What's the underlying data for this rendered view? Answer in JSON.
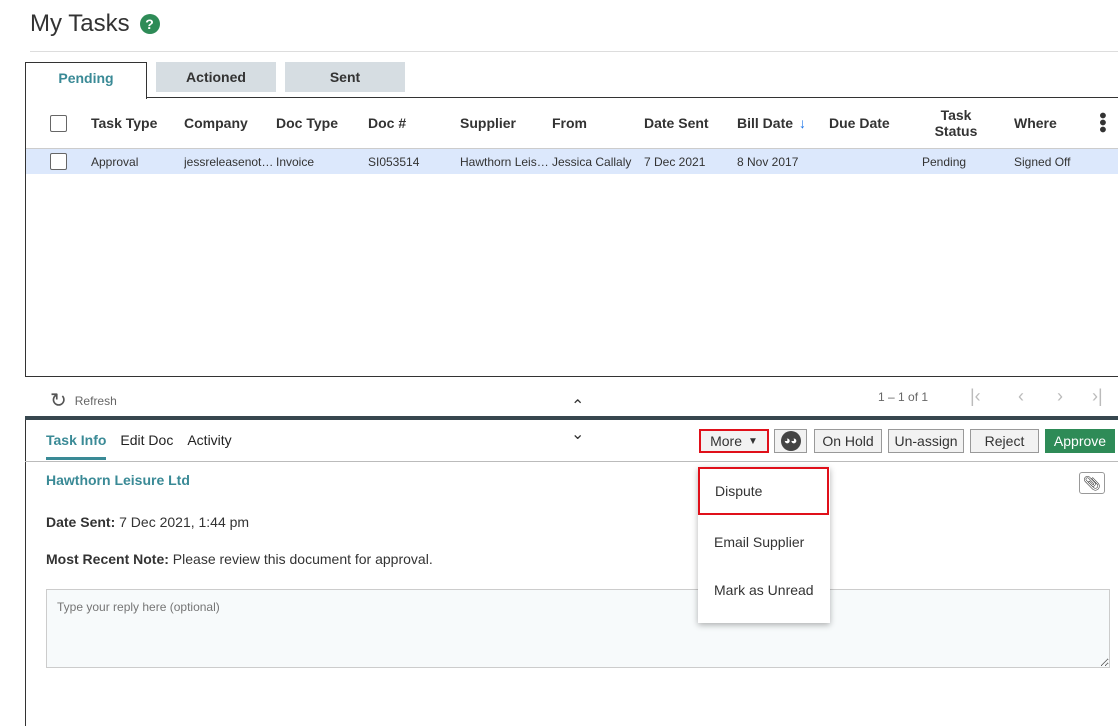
{
  "page": {
    "title": "My Tasks",
    "help_icon": "?"
  },
  "tabs": [
    {
      "label": "Pending",
      "active": true
    },
    {
      "label": "Actioned",
      "active": false
    },
    {
      "label": "Sent",
      "active": false
    }
  ],
  "grid": {
    "columns": [
      "Task Type",
      "Company",
      "Doc Type",
      "Doc #",
      "Supplier",
      "From",
      "Date Sent",
      "Bill Date",
      "Due Date",
      "Task Status",
      "Where"
    ],
    "sort_indicator": "↓",
    "rows": [
      {
        "task_type": "Approval",
        "company": "jessreleasenot…",
        "doc_type": "Invoice",
        "doc_no": "SI053514",
        "supplier": "Hawthorn Leis…",
        "from": "Jessica Callaly",
        "date_sent": "7 Dec 2021",
        "bill_date": "8 Nov 2017",
        "due_date": "",
        "task_status": "Pending",
        "where": "Signed Off"
      }
    ]
  },
  "pager": {
    "refresh_label": "Refresh",
    "count": "1 – 1 of 1"
  },
  "detail_tabs": [
    {
      "label": "Task Info",
      "active": true
    },
    {
      "label": "Edit Doc",
      "active": false
    },
    {
      "label": "Activity",
      "active": false
    }
  ],
  "actions": {
    "more": "More",
    "on_hold": "On Hold",
    "unassign": "Un-assign",
    "reject": "Reject",
    "approve": "Approve",
    "approve_color": "#2e8b57"
  },
  "more_menu": [
    "Dispute",
    "Email Supplier",
    "Mark as Unread"
  ],
  "detail": {
    "company": "Hawthorn Leisure Ltd",
    "date_sent_label": "Date Sent:",
    "date_sent_value": " 7 Dec 2021, 1:44 pm",
    "note_label": "Most Recent Note:",
    "note_value": " Please review this document for approval.",
    "reply_placeholder": "Type your reply here (optional)"
  },
  "colors": {
    "accent": "#3a8a96",
    "highlight_border": "#e0101a",
    "selected_row": "#dce8fc"
  }
}
